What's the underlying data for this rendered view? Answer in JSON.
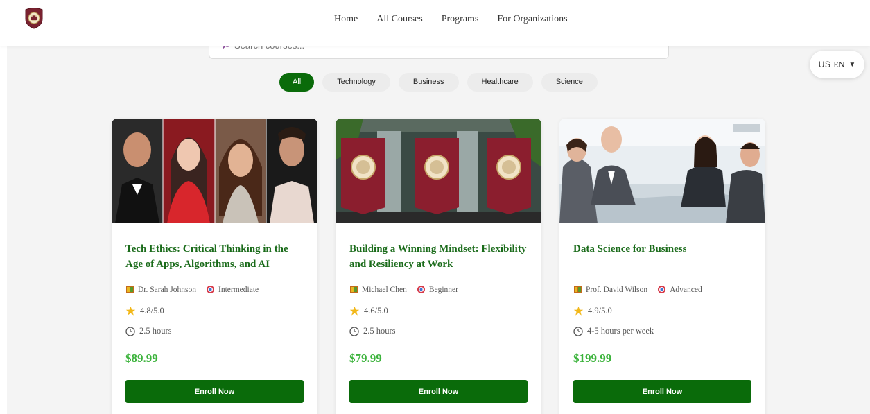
{
  "nav": {
    "links": [
      "Home",
      "All Courses",
      "Programs",
      "For Organizations"
    ]
  },
  "search": {
    "value": "",
    "placeholder": "Search courses..."
  },
  "language": {
    "flag": "US",
    "code": "EN",
    "caret": "▼"
  },
  "filters": [
    "All",
    "Technology",
    "Business",
    "Healthcare",
    "Science"
  ],
  "courses": [
    {
      "title": "Tech Ethics: Critical Thinking in the Age of Apps, Algorithms, and AI",
      "instructor": "Dr. Sarah Johnson",
      "level": "Intermediate",
      "rating": "4.8/5.0",
      "duration": "2.5 hours",
      "price": "$89.99",
      "cta": "Enroll Now"
    },
    {
      "title": "Building a Winning Mindset: Flexibility and Resiliency at Work",
      "instructor": "Michael Chen",
      "level": "Beginner",
      "rating": "4.6/5.0",
      "duration": "2.5 hours",
      "price": "$79.99",
      "cta": "Enroll Now"
    },
    {
      "title": "Data Science for Business",
      "instructor": "Prof. David Wilson",
      "level": "Advanced",
      "rating": "4.9/5.0",
      "duration": "4-5 hours per week",
      "price": "$199.99",
      "cta": "Enroll Now"
    }
  ],
  "colors": {
    "primary": "#0a6b0a",
    "title": "#1a6b1a",
    "price": "#3cb33c",
    "seal": "#7a2230"
  }
}
